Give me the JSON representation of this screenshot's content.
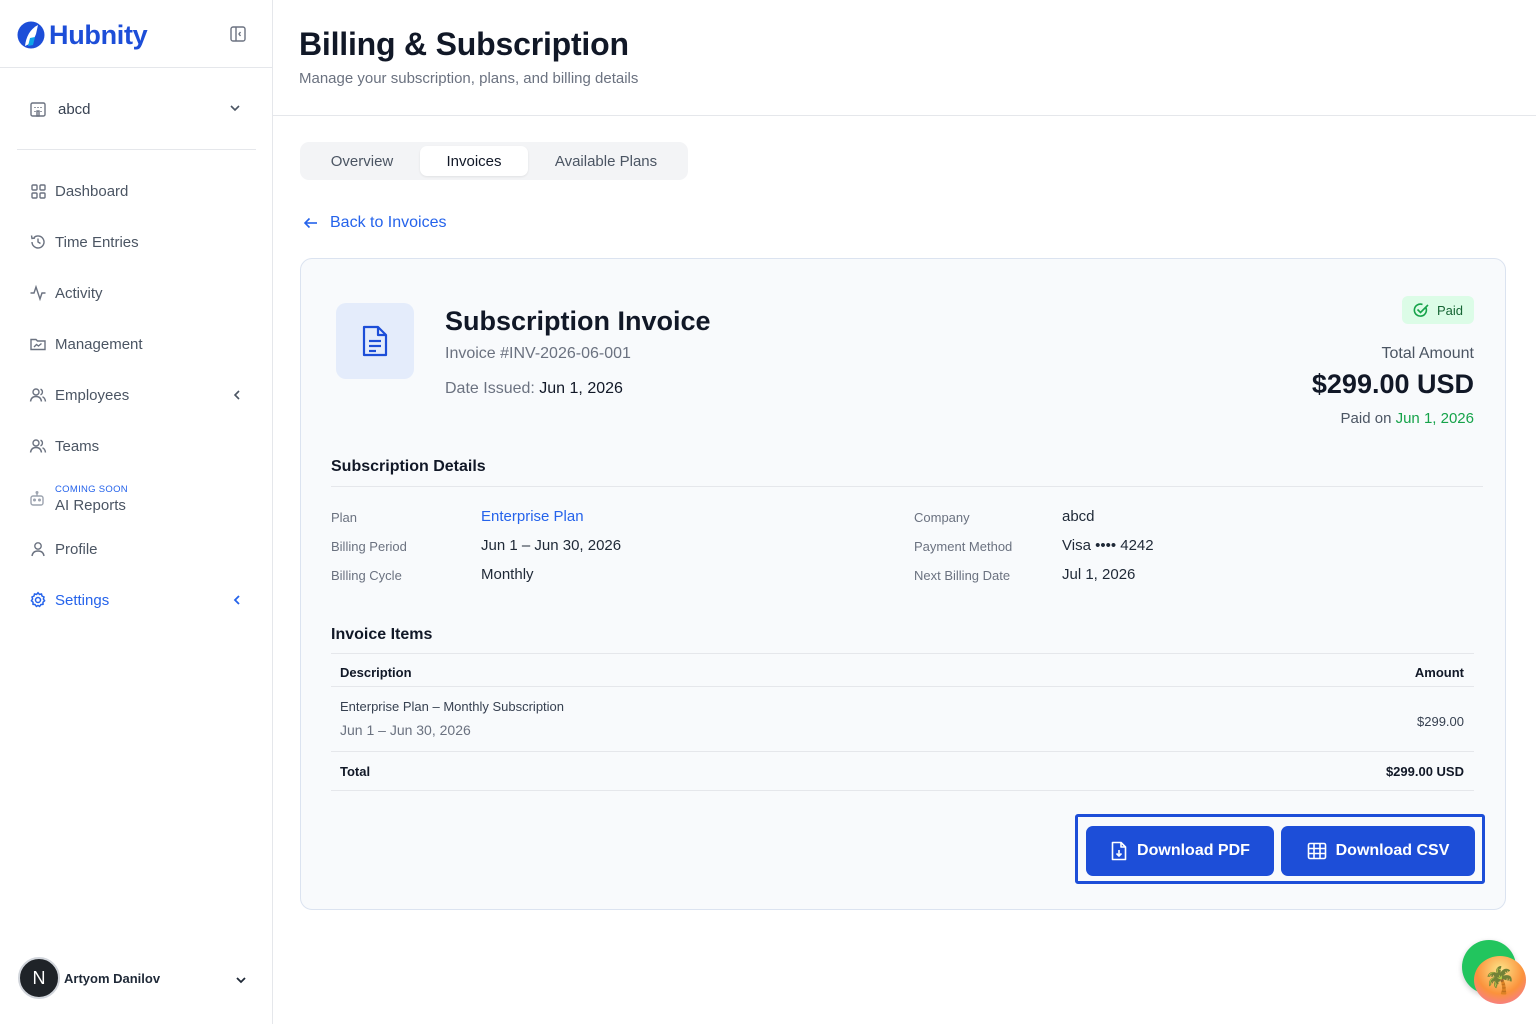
{
  "brand": {
    "name": "Hubnity",
    "accent": "#1d4ed8"
  },
  "workspace": {
    "name": "abcd"
  },
  "sidebar": {
    "items": [
      {
        "label": "Dashboard"
      },
      {
        "label": "Time Entries"
      },
      {
        "label": "Activity"
      },
      {
        "label": "Management"
      },
      {
        "label": "Employees"
      },
      {
        "label": "Teams"
      },
      {
        "label": "AI Reports",
        "badge": "COMING SOON"
      },
      {
        "label": "Profile"
      },
      {
        "label": "Settings"
      }
    ]
  },
  "user": {
    "initial": "N",
    "name": "Artyom Danilov"
  },
  "header": {
    "title": "Billing & Subscription",
    "subtitle": "Manage your subscription, plans, and billing details"
  },
  "tabs": [
    {
      "label": "Overview"
    },
    {
      "label": "Invoices",
      "selected": true
    },
    {
      "label": "Available Plans"
    }
  ],
  "back_link": "Back to Invoices",
  "invoice": {
    "title": "Subscription Invoice",
    "number": "Invoice #INV-2026-06-001",
    "date_label": "Date Issued:",
    "date_value": "Jun 1, 2026",
    "status": "Paid",
    "total_label": "Total Amount",
    "total_amount": "$299.00 USD",
    "paid_on_label": "Paid on",
    "paid_on_date": "Jun 1, 2026",
    "details_heading": "Subscription Details",
    "details": {
      "plan_label": "Plan",
      "plan_value": "Enterprise Plan",
      "period_label": "Billing Period",
      "period_value": "Jun 1 – Jun 30, 2026",
      "cycle_label": "Billing Cycle",
      "cycle_value": "Monthly",
      "company_label": "Company",
      "company_value": "abcd",
      "payment_label": "Payment Method",
      "payment_value": "Visa •••• 4242",
      "next_label": "Next Billing Date",
      "next_value": "Jul 1, 2026"
    },
    "items_heading": "Invoice Items",
    "table": {
      "headers": {
        "description": "Description",
        "amount": "Amount"
      },
      "rows": [
        {
          "description": "Enterprise Plan – Monthly Subscription",
          "period": "Jun 1 – Jun 30, 2026",
          "amount": "$299.00"
        }
      ],
      "total_label": "Total",
      "total_value": "$299.00 USD"
    },
    "actions": {
      "pdf": "Download PDF",
      "csv": "Download CSV"
    }
  },
  "chat": {
    "emoji": "🌴"
  }
}
